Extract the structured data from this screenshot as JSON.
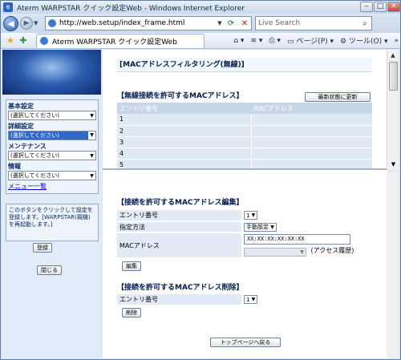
{
  "window": {
    "title": "Aterm WARPSTAR クイック設定Web - Windows Internet Explorer",
    "buttons": {
      "minimize": "–",
      "maximize": "□",
      "close": "✕"
    }
  },
  "address_bar": {
    "url": "http://web.setup/index_frame.html",
    "search_placeholder": "Live Search"
  },
  "command_bar": {
    "tab_title": "Aterm WARPSTAR クイック設定Web",
    "page_menu": "ページ(P)",
    "tools_menu": "ツール(O)"
  },
  "sidebar": {
    "sections": [
      {
        "label": "基本設定",
        "value": "(選択してください)"
      },
      {
        "label": "詳細設定",
        "value": "(選択してください)"
      },
      {
        "label": "メンテナンス",
        "value": "(選択してください)"
      },
      {
        "label": "情報",
        "value": "(選択してください)"
      }
    ],
    "menu_list_link": "メニュー一覧",
    "notice": "このボタンをクリックして設定を登録します。[WARPSTAR(親機)を再起動します。]",
    "register_button": "登録",
    "close_button": "閉じる"
  },
  "main": {
    "page_title": "[MACアドレスフィルタリング(無線)]",
    "allowed_list": {
      "heading": "【無線接続を許可するMACアドレス】",
      "update_button": "最新状態に更新",
      "columns": [
        "エントリ番号",
        "MACアドレス"
      ],
      "rows": [
        {
          "entry": "1",
          "mac": ""
        },
        {
          "entry": "2",
          "mac": ""
        },
        {
          "entry": "3",
          "mac": ""
        },
        {
          "entry": "4",
          "mac": ""
        },
        {
          "entry": "5",
          "mac": ""
        }
      ]
    },
    "edit_section": {
      "heading": "【接続を許可するMACアドレス編集】",
      "entry_label": "エントリ番号",
      "entry_value": "1",
      "method_label": "指定方法",
      "method_value": "手動設定",
      "mac_label": "MACアドレス",
      "mac_value": "XX:XX:XX:XX:XX:XX",
      "access_history_label": "(アクセス履歴)",
      "edit_button": "編集"
    },
    "delete_section": {
      "heading": "【接続を許可するMACアドレス削除】",
      "entry_label": "エントリ番号",
      "entry_value": "1",
      "delete_button": "削除"
    },
    "top_button": "トップページへ戻る"
  },
  "colors": {
    "sidebar_bg": "#e1ecf8",
    "table_header": "#c7d5e6",
    "table_row": "#dfe9f4",
    "selected_item": "#3169c6"
  }
}
